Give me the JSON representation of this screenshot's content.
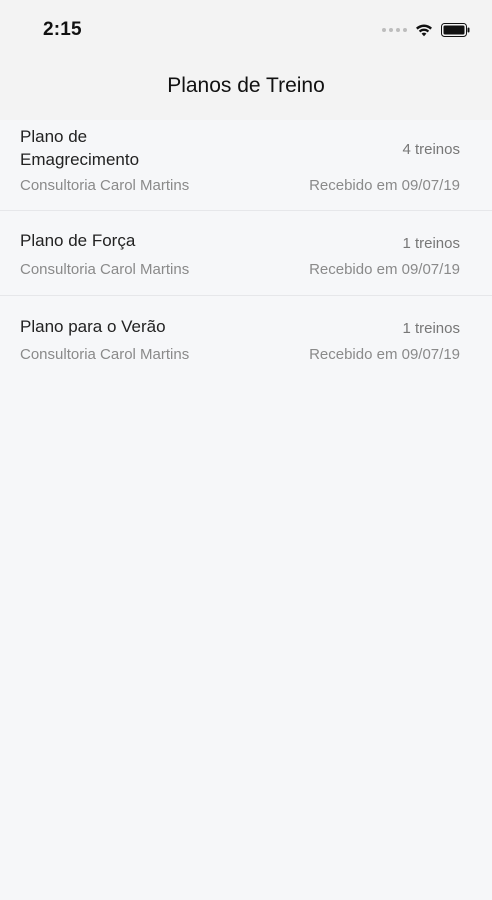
{
  "status_bar": {
    "time": "2:15"
  },
  "nav": {
    "title": "Planos de Treino"
  },
  "plans": [
    {
      "title_line1": "Plano de",
      "title_line2": "Emagrecimento",
      "count": "4 treinos",
      "consultant": "Consultoria Carol Martins",
      "received": "Recebido em 09/07/19"
    },
    {
      "title": "Plano de Força",
      "count": "1 treinos",
      "consultant": "Consultoria Carol Martins",
      "received": "Recebido em 09/07/19"
    },
    {
      "title": "Plano para o Verão",
      "count": "1 treinos",
      "consultant": "Consultoria Carol Martins",
      "received": "Recebido em 09/07/19"
    }
  ],
  "icons": {
    "signal": "cellular-signal-icon",
    "wifi": "wifi-icon",
    "battery": "battery-icon"
  },
  "colors": {
    "background": "#f6f7f9",
    "header": "#f3f3f3",
    "title_text": "#222222",
    "secondary_text": "#8a8a8a"
  }
}
